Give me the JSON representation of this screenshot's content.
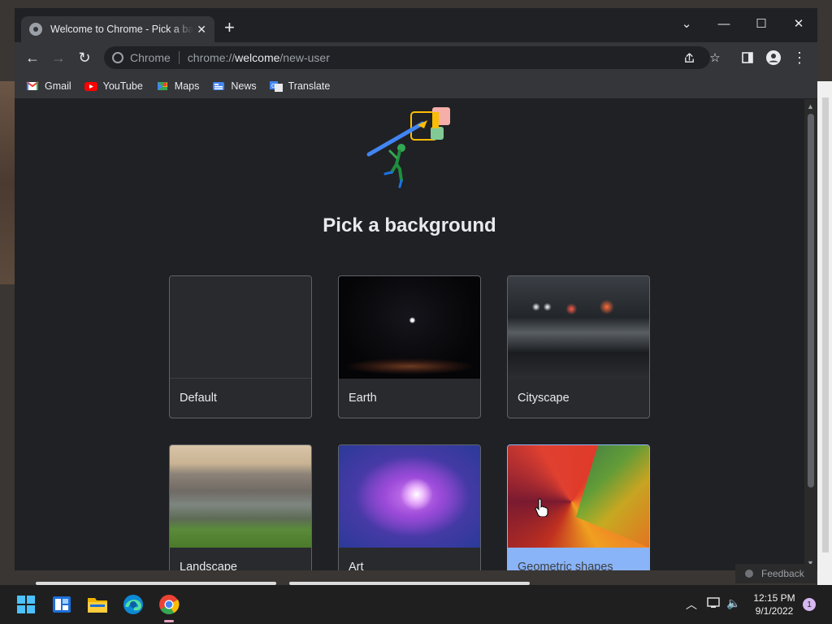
{
  "window": {
    "tab_title": "Welcome to Chrome - Pick a background",
    "new_tab_symbol": "+"
  },
  "controls": {
    "tab_search": "⌄",
    "minimize": "—",
    "maximize": "☐",
    "close": "✕"
  },
  "toolbar": {
    "back": "←",
    "forward": "→",
    "reload": "↻",
    "site_chip": "Chrome",
    "url_prefix": "chrome://",
    "url_host": "welcome",
    "url_path": "/new-user"
  },
  "bookmarks": [
    {
      "label": "Gmail",
      "icon": "gmail-icon",
      "color": "#ea4335"
    },
    {
      "label": "YouTube",
      "icon": "youtube-icon",
      "color": "#ff0000"
    },
    {
      "label": "Maps",
      "icon": "maps-icon",
      "color": "#34a853"
    },
    {
      "label": "News",
      "icon": "news-icon",
      "color": "#4285f4"
    },
    {
      "label": "Translate",
      "icon": "translate-icon",
      "color": "#4285f4"
    }
  ],
  "page": {
    "heading": "Pick a background",
    "backgrounds": [
      {
        "label": "Default",
        "selected": false
      },
      {
        "label": "Earth",
        "selected": false
      },
      {
        "label": "Cityscape",
        "selected": false
      },
      {
        "label": "Landscape",
        "selected": false
      },
      {
        "label": "Art",
        "selected": false
      },
      {
        "label": "Geometric shapes",
        "selected": true
      }
    ],
    "feedback": "Feedback"
  },
  "taskbar": {
    "time": "12:15 PM",
    "date": "9/1/2022",
    "notification_count": "1"
  },
  "colors": {
    "accent": "#8ab4f8",
    "window_bg": "#202124",
    "toolbar_bg": "#35363a"
  }
}
